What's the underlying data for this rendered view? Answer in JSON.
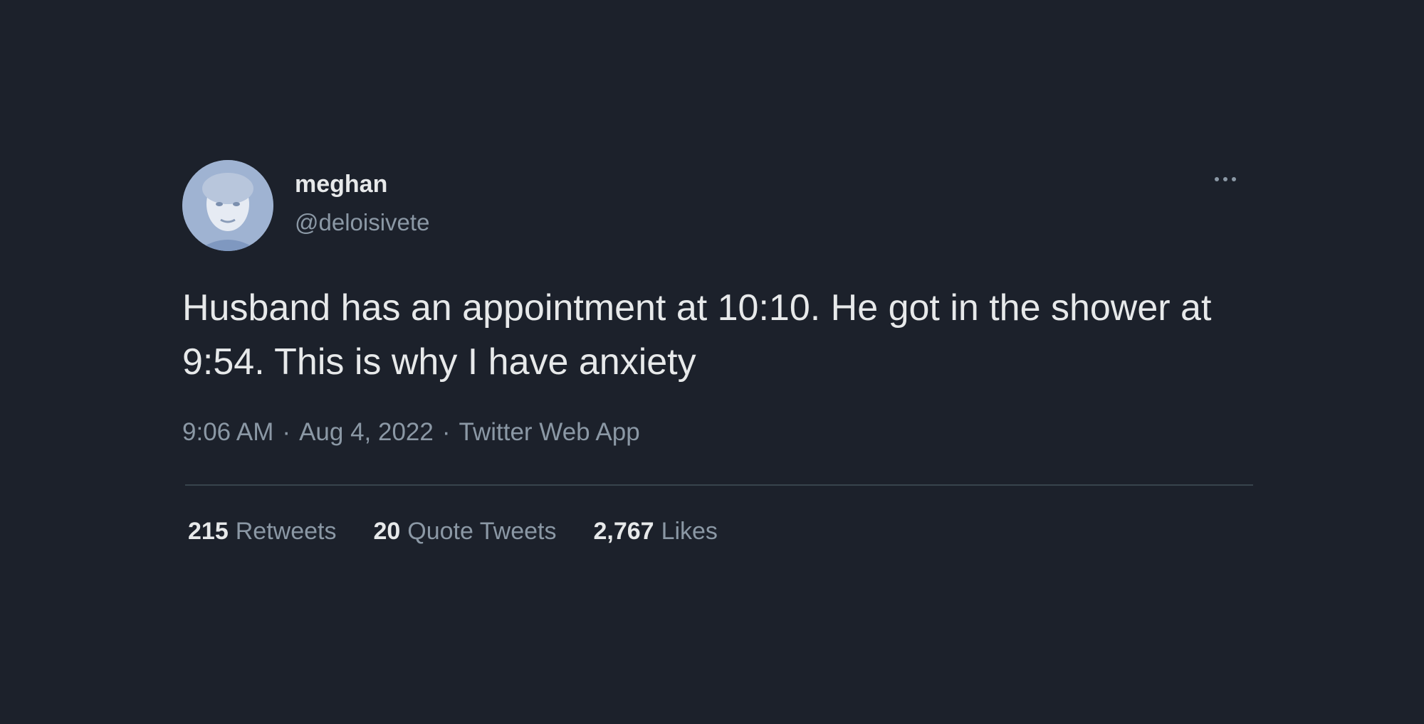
{
  "tweet": {
    "author": {
      "display_name": "meghan",
      "handle": "@deloisivete"
    },
    "text": "Husband has an appointment at 10:10. He got in the shower at 9:54. This is why I have anxiety",
    "time": "9:06 AM",
    "date": "Aug 4, 2022",
    "separator": "·",
    "source": "Twitter Web App",
    "stats": [
      {
        "count": "215",
        "label": "Retweets"
      },
      {
        "count": "20",
        "label": "Quote Tweets"
      },
      {
        "count": "2,767",
        "label": "Likes"
      }
    ]
  },
  "icons": {
    "more": "more-horizontal-icon",
    "avatar": "profile-photo"
  },
  "colors": {
    "background": "#1c212b",
    "primary_text": "#e7e9ea",
    "secondary_text": "#8b98a5",
    "divider": "#38444d"
  }
}
